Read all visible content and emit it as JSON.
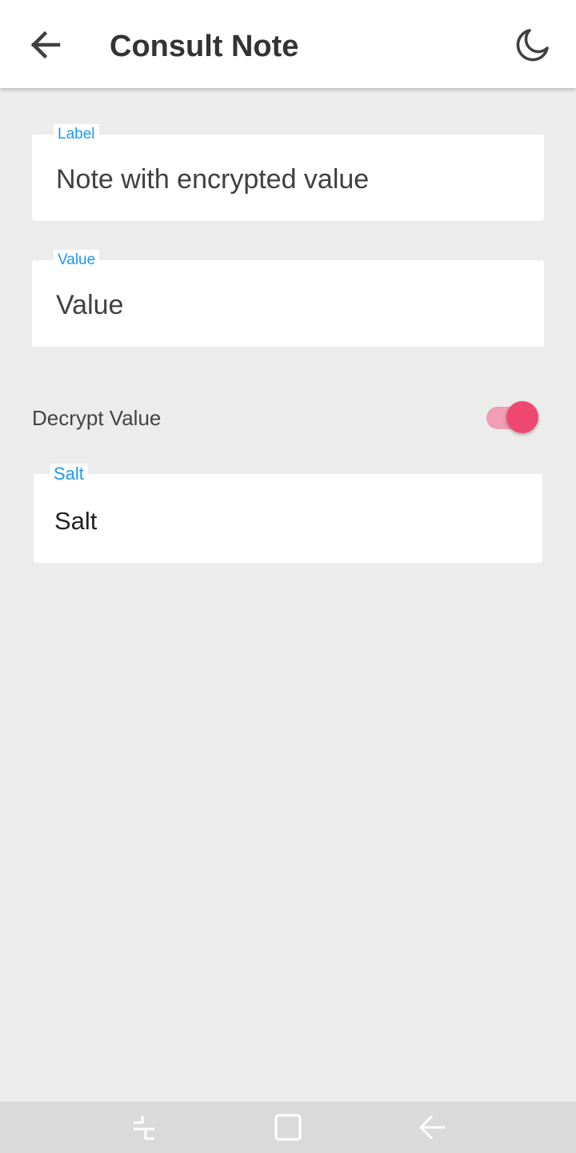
{
  "header": {
    "title": "Consult Note",
    "back_icon": "arrow-back-icon",
    "theme_icon": "moon-icon"
  },
  "form": {
    "label_field": {
      "legend": "Label",
      "value": "Note with encrypted value"
    },
    "value_field": {
      "legend": "Value",
      "value": "Value"
    },
    "decrypt_toggle": {
      "label": "Decrypt Value",
      "checked": true
    },
    "salt_field": {
      "legend": "Salt",
      "value": "Salt"
    }
  },
  "system_nav": {
    "recents_icon": "recents-icon",
    "home_icon": "home-icon",
    "back_icon": "nav-back-icon"
  },
  "colors": {
    "accent_blue": "#2196f3",
    "switch_thumb": "#ee4870",
    "switch_track": "#f19db5",
    "background": "#ececec"
  }
}
